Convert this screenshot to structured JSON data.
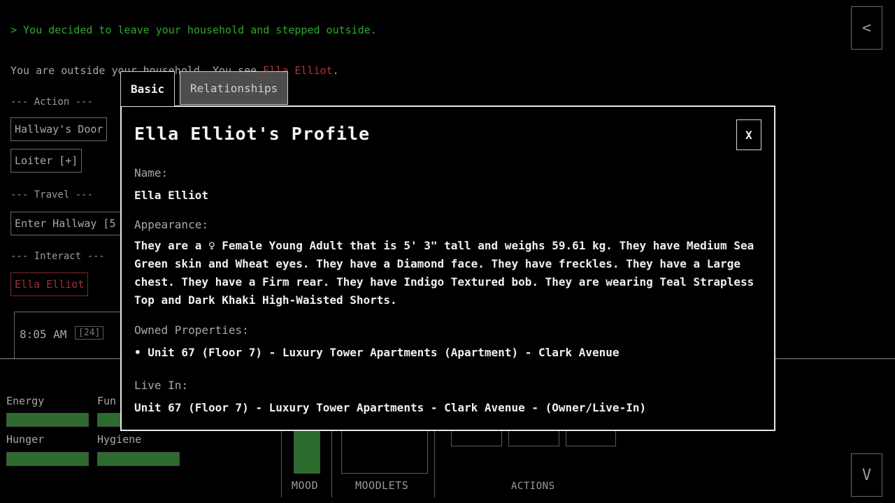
{
  "log": {
    "line1": "> You decided to leave your household and stepped outside.",
    "line2_prefix": "You are outside your household. You see ",
    "line2_npc": "Ella Elliot",
    "line2_suffix": "."
  },
  "sections": {
    "action": "--- Action ---",
    "travel": "--- Travel ---",
    "interact": "--- Interact ---"
  },
  "buttons": {
    "hallway_door": "Hallway's Door",
    "loiter": "Loiter [+]",
    "enter_hallway": "Enter Hallway [5",
    "ella_elliot": "Ella Elliot"
  },
  "clock": {
    "time": "8:05 AM",
    "mode": "[24]"
  },
  "corner": {
    "back": "<",
    "down": "V"
  },
  "stats": {
    "energy": {
      "label": "Energy",
      "level": 1.0
    },
    "fun": {
      "label": "Fun",
      "level": 1.0
    },
    "hunger": {
      "label": "Hunger",
      "level": 1.0
    },
    "hygiene": {
      "label": "Hygiene",
      "level": 1.0
    }
  },
  "bottom": {
    "mood": "MOOD",
    "moodlets": "MOODLETS",
    "actions": "ACTIONS"
  },
  "modal": {
    "tabs": {
      "basic": "Basic",
      "relationships": "Relationships"
    },
    "title": "Ella Elliot's Profile",
    "close": "X",
    "name_label": "Name:",
    "name_value": "Ella Elliot",
    "appearance_label": "Appearance:",
    "appearance_value": "They are a ♀ Female Young Adult that is 5' 3\" tall and weighs 59.61 kg. They have Medium Sea Green skin and Wheat eyes. They have a Diamond face. They have freckles. They have a Large chest. They have a Firm rear. They have Indigo Textured bob. They are wearing Teal Strapless Top and Dark Khaki High-Waisted Shorts.",
    "owned_label": "Owned Properties:",
    "owned_items": [
      "• Unit 67 (Floor 7) - Luxury Tower Apartments (Apartment) - Clark Avenue"
    ],
    "live_label": "Live In:",
    "live_value": "Unit 67 (Floor 7) - Luxury Tower Apartments - Clark Avenue - (Owner/Live-In)"
  },
  "colors": {
    "log_green": "#2fa82f",
    "npc_red": "#a83838",
    "bar_green": "#2e6b2e",
    "tab_inactive": "#4d4d4d"
  }
}
